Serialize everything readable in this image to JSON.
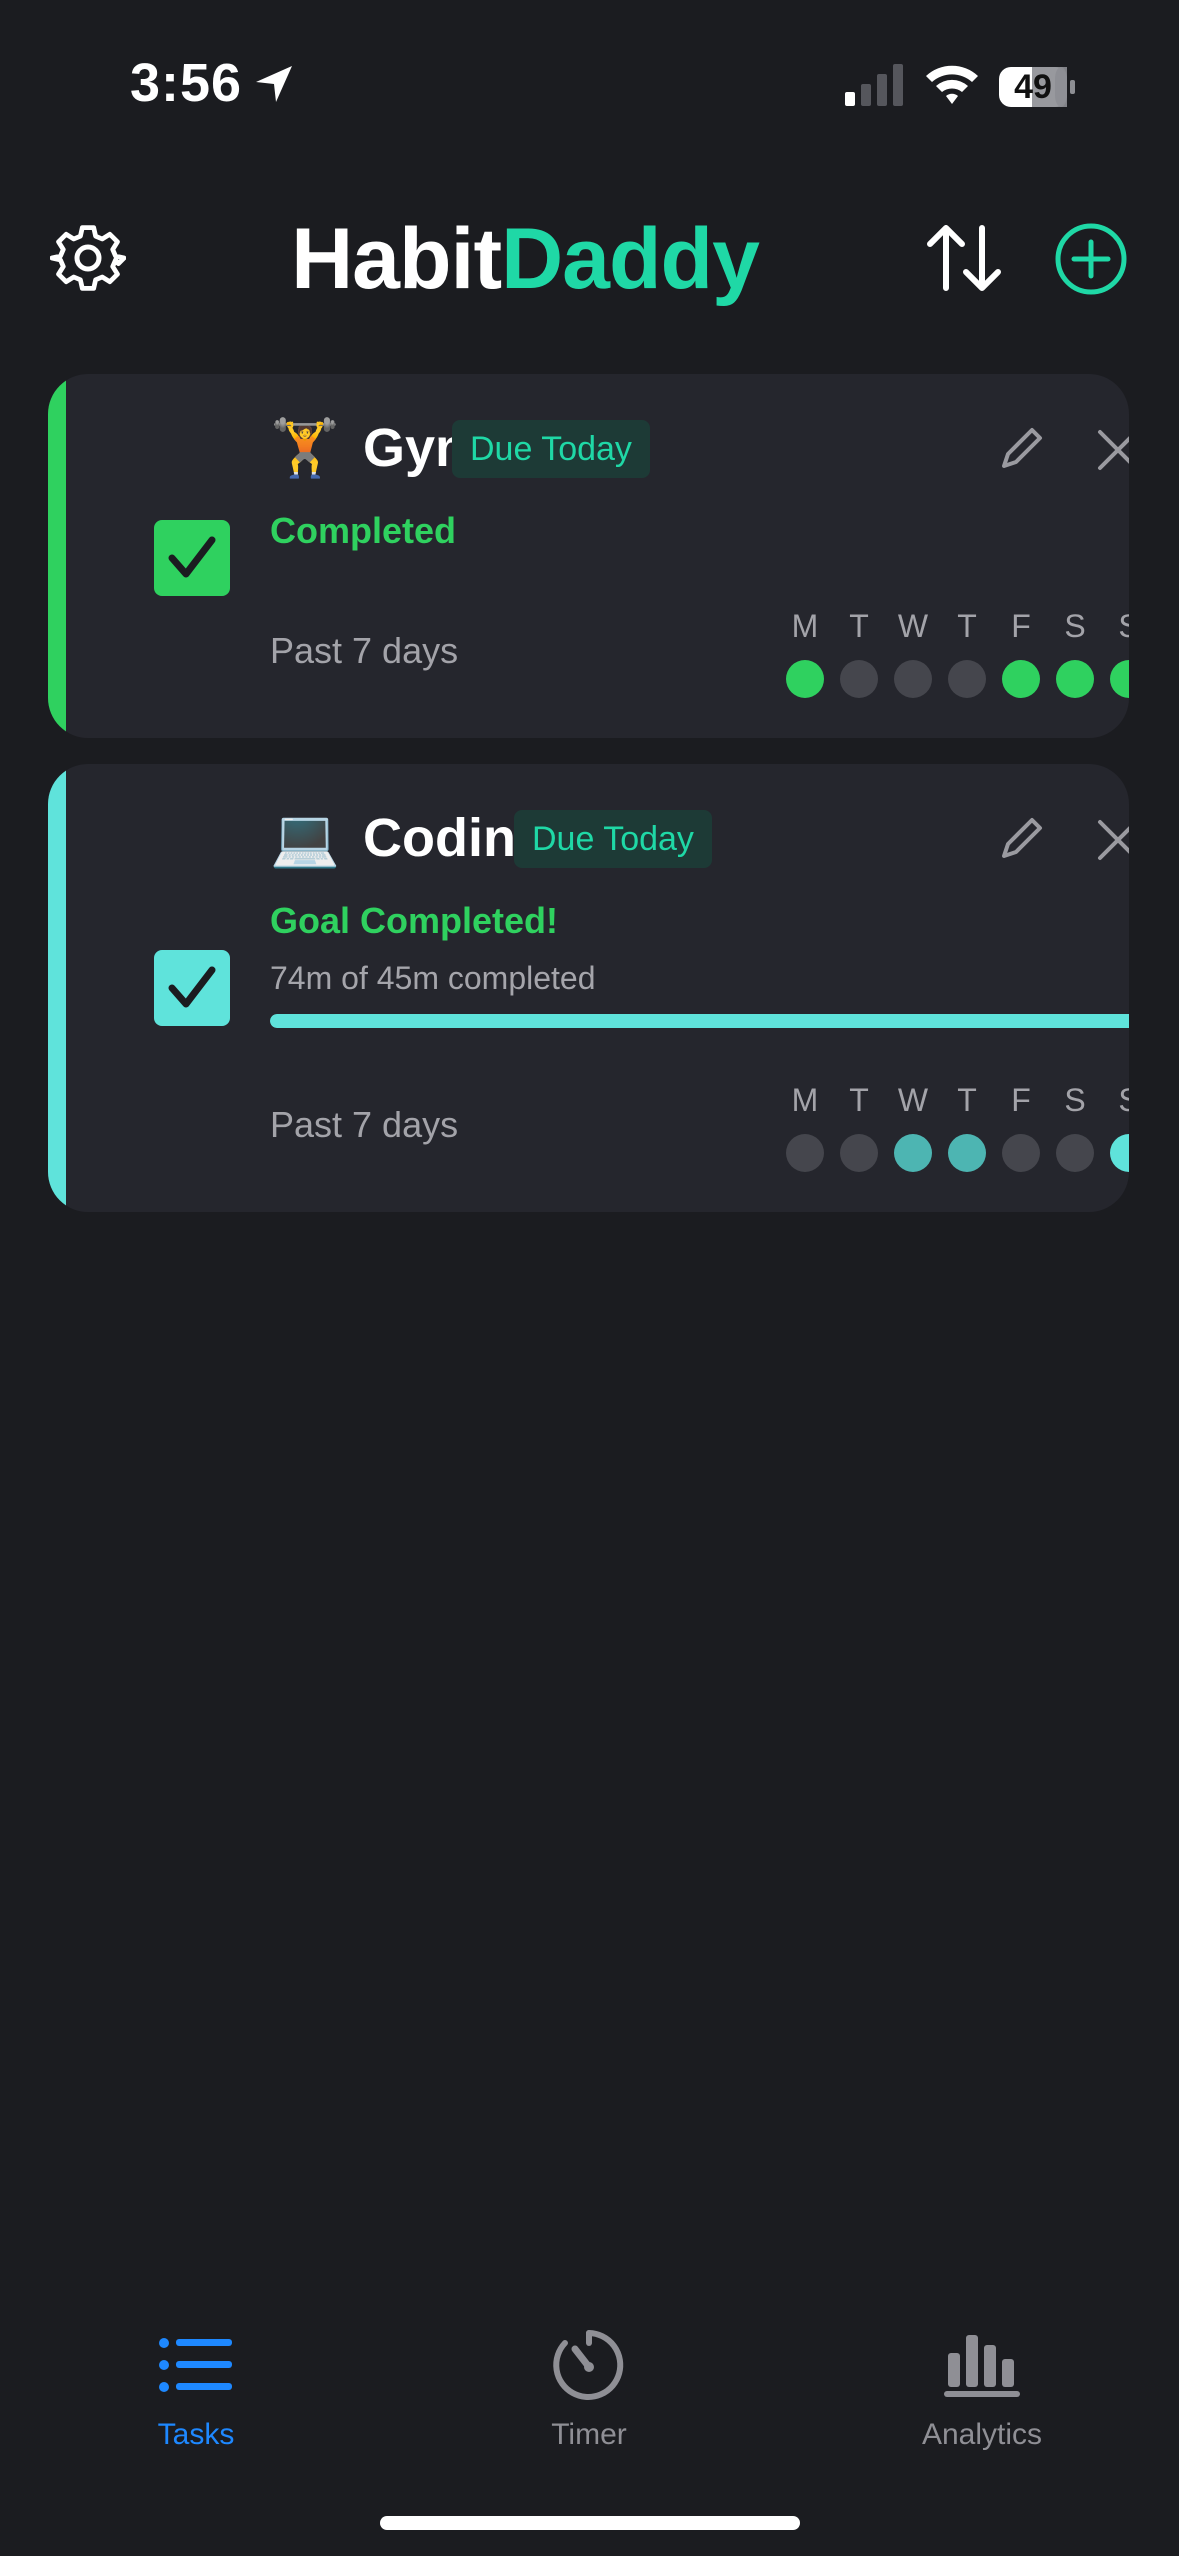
{
  "status_bar": {
    "time": "3:56",
    "battery": "49"
  },
  "header": {
    "title_part1": "Habit",
    "title_part2": "Daddy",
    "accent_color": "#1fd8a6"
  },
  "day_labels": [
    "M",
    "T",
    "W",
    "T",
    "F",
    "S",
    "S"
  ],
  "habits": [
    {
      "emoji": "🏋️",
      "name": "Gym",
      "badge": "Due Today",
      "status": "Completed",
      "past_label": "Past 7 days",
      "color": "#2fd15f",
      "checked": true,
      "days_done": [
        true,
        false,
        false,
        false,
        true,
        true,
        true
      ]
    },
    {
      "emoji": "💻",
      "name": "Coding",
      "badge": "Due Today",
      "status": "Goal Completed!",
      "progress_text": "74m of 45m completed",
      "progress_fraction": 1.0,
      "past_label": "Past 7 days",
      "color": "#5fe3db",
      "checked": true,
      "days_done": [
        false,
        false,
        true,
        true,
        false,
        false,
        true
      ]
    }
  ],
  "tabs": [
    {
      "label": "Tasks",
      "icon": "list-icon",
      "active": true
    },
    {
      "label": "Timer",
      "icon": "timer-icon",
      "active": false
    },
    {
      "label": "Analytics",
      "icon": "bar-chart-icon",
      "active": false
    }
  ]
}
